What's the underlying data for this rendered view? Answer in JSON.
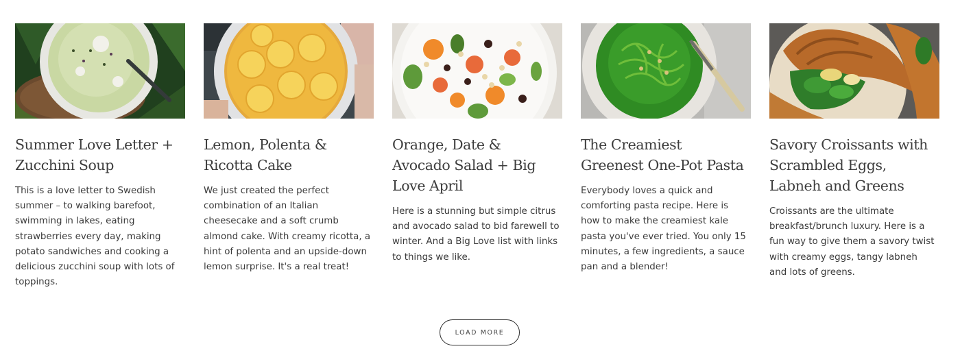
{
  "posts": [
    {
      "title": "Summer Love Letter + Zucchini Soup",
      "excerpt": "This is a love letter to Swedish summer – to walking barefoot, swimming in lakes, eating strawberries every day, making potato sandwiches and cooking a delicious zucchini soup with lots of toppings."
    },
    {
      "title": "Lemon, Polenta & Ricotta Cake",
      "excerpt": "We just created the perfect combination of an Italian cheesecake and a soft crumb almond cake. With creamy ricotta, a hint of polenta and an upside-down lemon surprise. It's a real treat!"
    },
    {
      "title": "Orange, Date & Avocado Salad + Big Love April",
      "excerpt": "Here is a stunning but simple citrus and avocado salad to bid farewell to winter. And a Big Love list with links to things we like."
    },
    {
      "title": "The Creamiest Greenest One-Pot Pasta",
      "excerpt": "Everybody loves a quick and comforting pasta recipe. Here is how to make the creamiest kale pasta you've ever tried. You only 15 minutes, a few ingredients, a sauce pan and a blender!"
    },
    {
      "title": "Savory Croissants with Scrambled Eggs, Labneh and Greens",
      "excerpt": "Croissants are the ultimate breakfast/brunch luxury. Here is a fun way to give them a savory twist with creamy eggs, tangy labneh and lots of greens."
    }
  ],
  "load_more": {
    "label": "LOAD MORE"
  }
}
